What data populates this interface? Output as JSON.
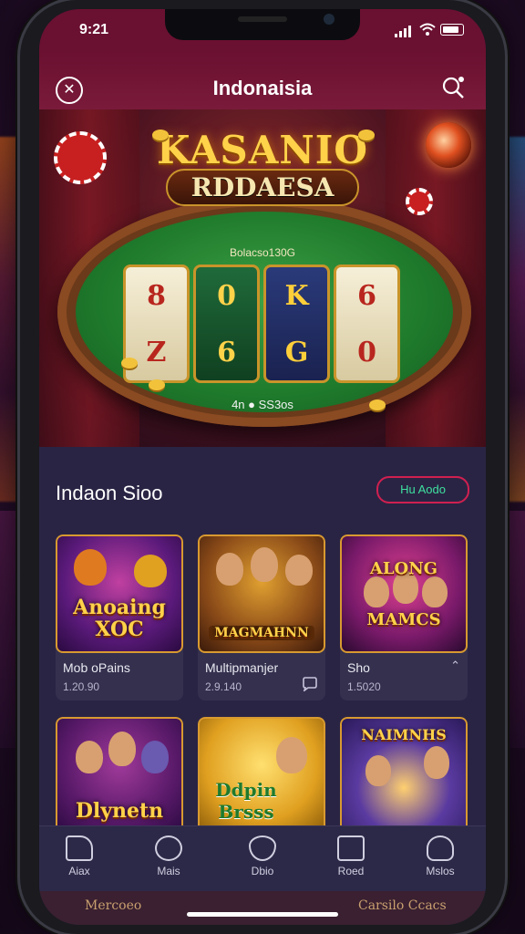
{
  "status": {
    "time": "9:21"
  },
  "header": {
    "title": "Indonaisia"
  },
  "hero": {
    "logo_line1": "KASANIO",
    "logo_line2": "RDDAESA",
    "balance": "Bolacso130G",
    "reel_symbols": [
      "8",
      "Z",
      "0",
      "6",
      "K",
      "G",
      "6",
      "0"
    ],
    "bet_text": "4n ● SS3os"
  },
  "section": {
    "title": "Indaon Sioo",
    "view_button": "Hu Aodo"
  },
  "games": [
    {
      "art": "Anoaing XOC",
      "name": "Mob oPains",
      "value": "1.20.90",
      "icon": ""
    },
    {
      "art": "MAGMAHNN",
      "name": "Multipmanjer",
      "value": "2.9.140",
      "icon": "chat-icon"
    },
    {
      "art": "ALONG MAMCS",
      "name": "Sho",
      "value": "1.5020",
      "icon": "chevron-up-icon"
    },
    {
      "art": "Dlynetn",
      "name": "",
      "value": "",
      "icon": ""
    },
    {
      "art": "Ddpin Brsss",
      "name": "",
      "value": "",
      "icon": ""
    },
    {
      "art": "NAIMNHS",
      "name": "",
      "value": "",
      "icon": ""
    }
  ],
  "nav": [
    {
      "label": "Aiax",
      "icon": "home-icon"
    },
    {
      "label": "Mais",
      "icon": "user-icon"
    },
    {
      "label": "Dbio",
      "icon": "shield-icon"
    },
    {
      "label": "Roed",
      "icon": "bag-icon"
    },
    {
      "label": "Mslos",
      "icon": "profile-icon"
    }
  ],
  "peek": {
    "left": "Mercoeo",
    "right": "Carsilo Ccacs"
  },
  "colors": {
    "header": "#6a1030",
    "panel": "#2a2444",
    "accent": "#d02050",
    "gold": "#ffd24a"
  }
}
